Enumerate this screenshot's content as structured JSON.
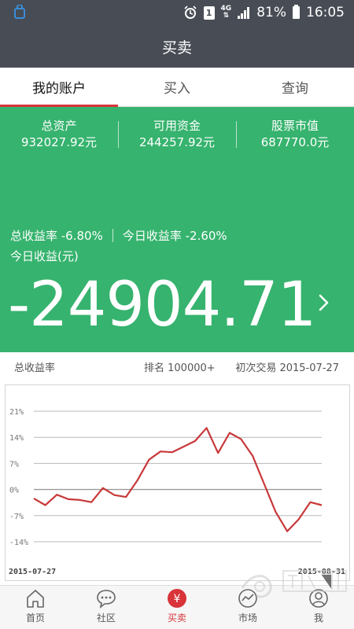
{
  "status_bar": {
    "battery": "81%",
    "time": "16:05",
    "sim_label": "1",
    "network_label": "4G"
  },
  "header": {
    "title": "买卖"
  },
  "tabs": [
    {
      "label": "我的账户",
      "active": true
    },
    {
      "label": "买入",
      "active": false
    },
    {
      "label": "查询",
      "active": false
    }
  ],
  "account": {
    "stats": [
      {
        "label": "总资产",
        "value": "932027.92元"
      },
      {
        "label": "可用资金",
        "value": "244257.92元"
      },
      {
        "label": "股票市值",
        "value": "687770.0元"
      }
    ],
    "total_return_rate": "总收益率 -6.80%",
    "today_return_rate": "今日收益率 -2.60%",
    "today_profit_label": "今日收益(元)",
    "today_profit_value": "-24904.71",
    "panel_color": "#36b36e"
  },
  "info": {
    "total_return_label": "总收益率",
    "rank": "排名 100000+",
    "first_trade": "初次交易 2015-07-27"
  },
  "chart_data": {
    "type": "line",
    "title": "",
    "xlabel": "",
    "ylabel": "",
    "x_start": "2015-07-27",
    "x_end": "2015-08-31",
    "ytick_labels": [
      "21%",
      "14%",
      "7%",
      "0%",
      "-7%",
      "-14%"
    ],
    "ylim": [
      -14,
      21
    ],
    "grid": true,
    "series": [
      {
        "color": "#c8383a",
        "values": [
          -2.4,
          -4.2,
          -1.4,
          -2.6,
          -2.8,
          -3.4,
          0.4,
          -1.5,
          -2.0,
          2.5,
          8.0,
          10.2,
          10.0,
          11.5,
          13.0,
          16.5,
          9.8,
          15.2,
          13.5,
          9.0,
          1.5,
          -6.0,
          -11.2,
          -8.0,
          -3.4,
          -4.2
        ]
      }
    ]
  },
  "bottom_nav": [
    {
      "label": "首页",
      "icon": "home-icon",
      "active": false
    },
    {
      "label": "社区",
      "icon": "chat-icon",
      "active": false
    },
    {
      "label": "买卖",
      "icon": "yen-icon",
      "active": true
    },
    {
      "label": "市场",
      "icon": "market-icon",
      "active": false
    },
    {
      "label": "我",
      "icon": "profile-icon",
      "active": false
    }
  ],
  "colors": {
    "header_bg": "#474c55",
    "accent_red": "#d8343a",
    "gain_green": "#36b36e"
  }
}
